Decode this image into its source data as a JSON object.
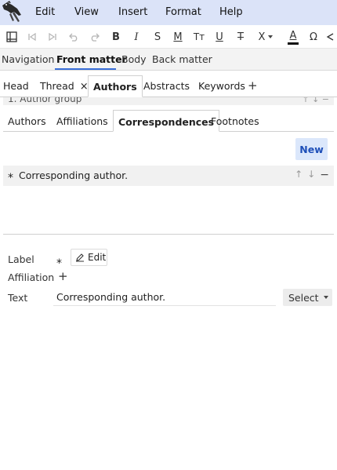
{
  "menu": [
    "Edit",
    "View",
    "Insert",
    "Format",
    "Help"
  ],
  "toolbar": {
    "bold": "B",
    "italic": "I",
    "strike_s": "S",
    "mono": "M",
    "smallcaps": "Tт",
    "underline": "U",
    "strikethrough": "T",
    "math": "X",
    "textcolor": "A",
    "omega": "Ω"
  },
  "main_tabs": [
    "Navigation",
    "Front matter",
    "Body",
    "Back matter"
  ],
  "sub_tabs": {
    "head": "Head",
    "thread": "Thread",
    "authors": "Authors",
    "abstracts": "Abstracts",
    "keywords": "Keywords",
    "add": "+"
  },
  "author_group": {
    "label": "1. Author group"
  },
  "inner_tabs": [
    "Authors",
    "Affiliations",
    "Correspondences",
    "Footnotes"
  ],
  "new_button": "New",
  "correspondence": {
    "label": "*",
    "text": "Corresponding author."
  },
  "form": {
    "label_label": "Label",
    "label_value": "*",
    "edit_button": "Edit",
    "affiliation_label": "Affiliation",
    "affiliation_add": "+",
    "text_label": "Text",
    "text_value": "Corresponding author.",
    "select_button": "Select"
  },
  "colors": {
    "menubar": "#dbe3f8",
    "accent": "#3a6fd8",
    "new_bg": "#dbe7fb",
    "new_fg": "#1e4fb8"
  }
}
